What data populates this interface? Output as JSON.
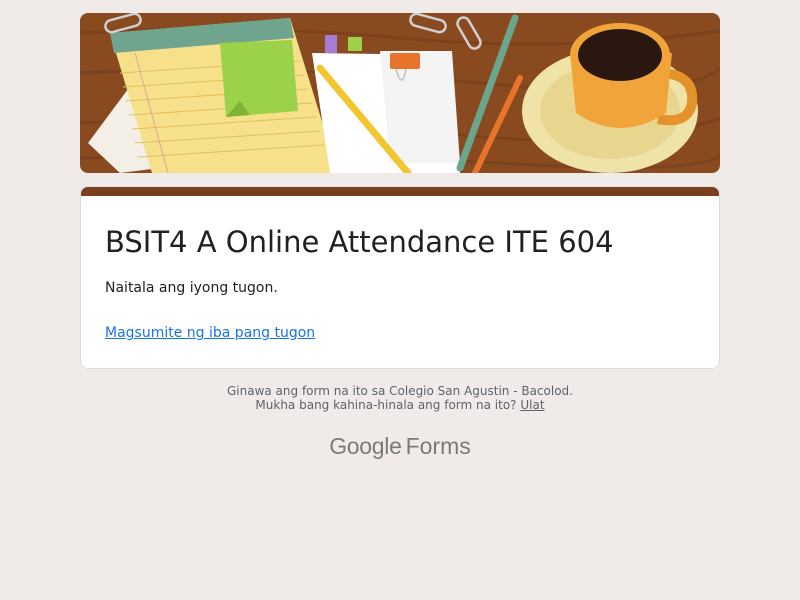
{
  "form": {
    "title": "BSIT4 A Online Attendance ITE 604",
    "confirmation": "Naitala ang iyong tugon.",
    "resubmit_link": "Magsumite ng iba pang tugon",
    "accent_color": "#7a3f1e",
    "link_color": "#1a73e8"
  },
  "banner": {
    "icon": "desk-stationery-coffee-illustration"
  },
  "footer": {
    "created_text": "Ginawa ang form na ito sa Colegio San Agustin - Bacolod.",
    "suspicious_text": "Mukha bang kahina-hinala ang form na ito?",
    "report_link": "Ulat"
  },
  "brand": {
    "google": "Google",
    "forms": "Forms"
  }
}
